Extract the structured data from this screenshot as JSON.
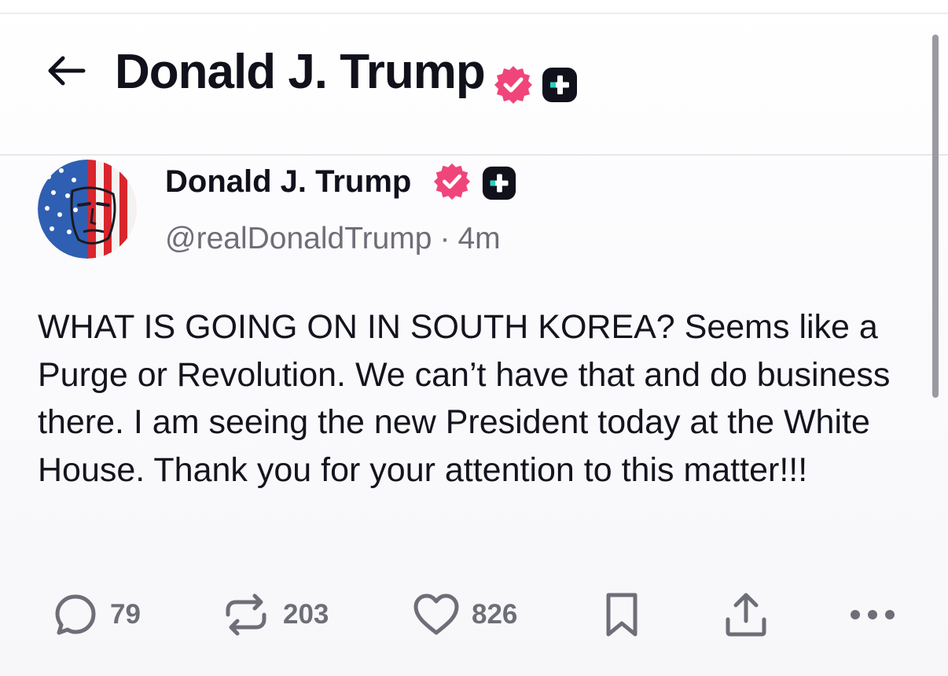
{
  "header": {
    "title": "Donald J. Trump",
    "back_icon": "arrow-left-icon",
    "verified_icon": "verified-badge-icon",
    "plus_icon": "truth-plus-icon"
  },
  "post": {
    "author_name": "Donald J. Trump",
    "handle": "@realDonaldTrump",
    "separator": "·",
    "time": "4m",
    "text": "WHAT IS GOING ON IN SOUTH KOREA? Seems like a Purge or Revolution. We can’t have that and do business there. I am seeing the new President today at the White House. Thank you for your attention to this matter!!!"
  },
  "actions": {
    "replies": "79",
    "retruths": "203",
    "likes": "826",
    "icons": [
      "reply-icon",
      "retruth-icon",
      "heart-icon",
      "bookmark-icon",
      "share-icon",
      "more-icon"
    ]
  },
  "colors": {
    "verified": "#f0457a",
    "text": "#11111c",
    "muted": "#6e6e78",
    "icon_gray": "#6e6e78"
  }
}
